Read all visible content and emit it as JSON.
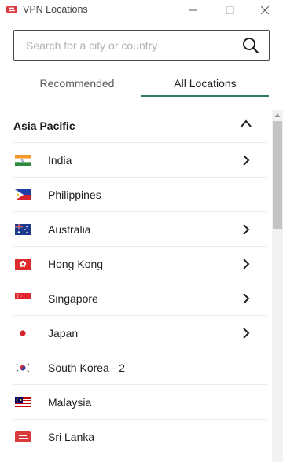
{
  "window": {
    "title": "VPN Locations",
    "accent_color": "#2f7d62",
    "brand_color": "#da3940"
  },
  "search": {
    "placeholder": "Search for a city or country",
    "value": ""
  },
  "tabs": [
    {
      "label": "Recommended",
      "selected": false
    },
    {
      "label": "All Locations",
      "selected": true
    }
  ],
  "section": {
    "title": "Asia Pacific",
    "expanded": true
  },
  "locations": [
    {
      "name": "India",
      "flag": "india-flag-icon",
      "has_submenu": true
    },
    {
      "name": "Philippines",
      "flag": "philippines-flag-icon",
      "has_submenu": false
    },
    {
      "name": "Australia",
      "flag": "australia-flag-icon",
      "has_submenu": true
    },
    {
      "name": "Hong Kong",
      "flag": "hong-kong-flag-icon",
      "has_submenu": true
    },
    {
      "name": "Singapore",
      "flag": "singapore-flag-icon",
      "has_submenu": true
    },
    {
      "name": "Japan",
      "flag": "japan-flag-icon",
      "has_submenu": true
    },
    {
      "name": "South Korea - 2",
      "flag": "south-korea-flag-icon",
      "has_submenu": false
    },
    {
      "name": "Malaysia",
      "flag": "malaysia-flag-icon",
      "has_submenu": false
    },
    {
      "name": "Sri Lanka",
      "flag": "sri-lanka-flag-icon",
      "has_submenu": false
    }
  ]
}
